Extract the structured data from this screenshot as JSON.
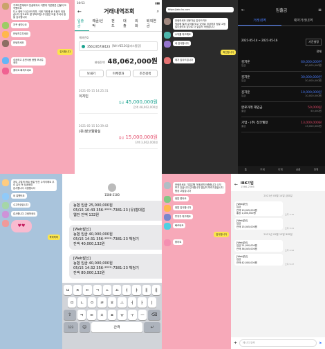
{
  "panel1": {
    "msgs": [
      "기프티콘재테크 전설에게서 이렇게 기분좋은 선물이 도착했어요\n다시 한번 더 감사드리며, 이번 기회에 큰 도움이 되었습니다 앞으로도 잘 부탁드립니다 많은 도움 주셔서 정말 감사합니다",
      "자꾸 생각나요",
      "안녕히주무세요",
      "안녕하세요",
      "감사합니다",
      "성공하고 돈번사람 응원 보내주세요",
      "좋아요 빠져드네요"
    ]
  },
  "panel2": {
    "time": "10:53",
    "title": "거래내역조회",
    "tabs": [
      "입출금",
      "예금/신탁",
      "펀드",
      "대출",
      "외화",
      "퇴직연금"
    ],
    "account_label": "계좌번호",
    "account_no": "3561205738123",
    "account_name": "[NH AE120플러스통장]",
    "balance_label": "현재잔액",
    "balance": "48,062,000원",
    "buttons": [
      "보내기",
      "이체결과",
      "조건검색"
    ],
    "tx": [
      {
        "date": "2021-05-15 14:25:31",
        "desc": "이지민",
        "kind": "입금",
        "amount": "45,000,000원",
        "after": "잔액 48,062,000원"
      },
      {
        "date": "2021-05-15 10:39:42",
        "desc": "(유)청코웰항실",
        "kind": "출금",
        "amount": "15,000,000원",
        "after": "잔액 3,062,000원"
      }
    ]
  },
  "panel3": {
    "url": "https://abc.ku.com",
    "msgs": [
      "안녕하세요 전문가님 감사드려요\n덕분에 벌써 수익을 보고 있어요 지금까지 정말 고생 많으셨어요 앞으로 더 열심히 하겠습니다",
      "수익률 최고예요",
      "네 감사합니다",
      "확인합니다",
      "제가 감사드립니다"
    ]
  },
  "panel4": {
    "title": "입출금",
    "tabs": [
      "거래내역",
      "예약거래내역"
    ],
    "range": "2021-05-14 ~ 2021-05-16",
    "filter": "기간설정",
    "all": "전체",
    "items": [
      {
        "name": "김지훈",
        "kind": "입금",
        "amount": "60,000,000원",
        "after": "60,000,000원"
      },
      {
        "name": "김지훈",
        "kind": "입금",
        "amount": "30,000,000원",
        "after": "30,000,000원"
      },
      {
        "name": "김지훈",
        "kind": "입금",
        "amount": "10,000,000원",
        "after": "10,000,000원"
      },
      {
        "name": "완료거래 재입금",
        "kind": "출금",
        "amount": "50,000원",
        "after": "50,000원"
      },
      {
        "name": "기업 - (주) 청코웰항",
        "kind": "출금",
        "amount": "13,000,000원",
        "after": "13,000,000원"
      }
    ],
    "nav": [
      "홈",
      "조회",
      "이체",
      "상품",
      "전체"
    ]
  },
  "panel5": {
    "msgs": [
      "저도 그렇게 봐요 정말 멋진 수익이에요 우리 같이 꼭 성공해요\n감사합니다 사랑합니다",
      "네 잘했어요",
      "수고하셨습니다",
      "감사합니다 고생하세요",
      "축하축하"
    ]
  },
  "panel6": {
    "sender": "1588-2100",
    "sms": [
      "농협 입금 25,000,000원\n05/15 10:43 356-****-7381-23 (유)협대업\n웹만 잔액 132원",
      "[Web발신]\n농협 입금 40,000,000원\n05/15 14:31 356-****-7381-23 백정기\n잔액 40,000,132원",
      "[Web발신]\n농협 입금 40,000,000원\n05/15 14:32 356-****-7381-23 백정기\n잔액 80,000,132원"
    ],
    "keys_row1": [
      "ㅂ",
      "ㅈ",
      "ㄷ",
      "ㄱ",
      "ㅅ",
      "ㅛ",
      "ㅕ",
      "ㅑ",
      "ㅐ",
      "ㅔ"
    ],
    "keys_row2": [
      "ㅁ",
      "ㄴ",
      "ㅇ",
      "ㄹ",
      "ㅎ",
      "ㅗ",
      "ㅓ",
      "ㅏ",
      "ㅣ"
    ],
    "keys_row3": [
      "ㅋ",
      "ㅌ",
      "ㅊ",
      "ㅍ",
      "ㅠ",
      "ㅜ",
      "ㅡ"
    ],
    "space": "간격"
  },
  "panel7": {
    "msgs": [
      "안녕하세요 기업은행 거래내역 인증합니다 수익 보고 있습니다 감사합니다 열심히 따라가겠습니다 항상 고맙습니다",
      "정말 좋아요",
      "정말 감사합니다",
      "투자가 최고예요",
      "빠르네요",
      "감사합니다",
      "좋아요"
    ]
  },
  "panel8": {
    "title": "IBK기업",
    "sub": "1566-2566",
    "dates": [
      "2021년 05월 14일 금요일",
      "2021년 05월 15일 토요일"
    ],
    "msgs": [
      "[Web발신]\n입금\n잔액 10,045,000원\n통장 1,000,000원",
      "[Web발신]\n입금\n잔액 15,045,000원",
      "[Web발신]\n입금 21,000,000원\n잔액 36,045,000원",
      "[Web발신]\n입금\n잔액 42,000,000원"
    ],
    "times": [
      "오후 3:10",
      "오후 3:21",
      "오후 4:58",
      "오후 5:27"
    ],
    "input_placeholder": "메시지 입력"
  }
}
